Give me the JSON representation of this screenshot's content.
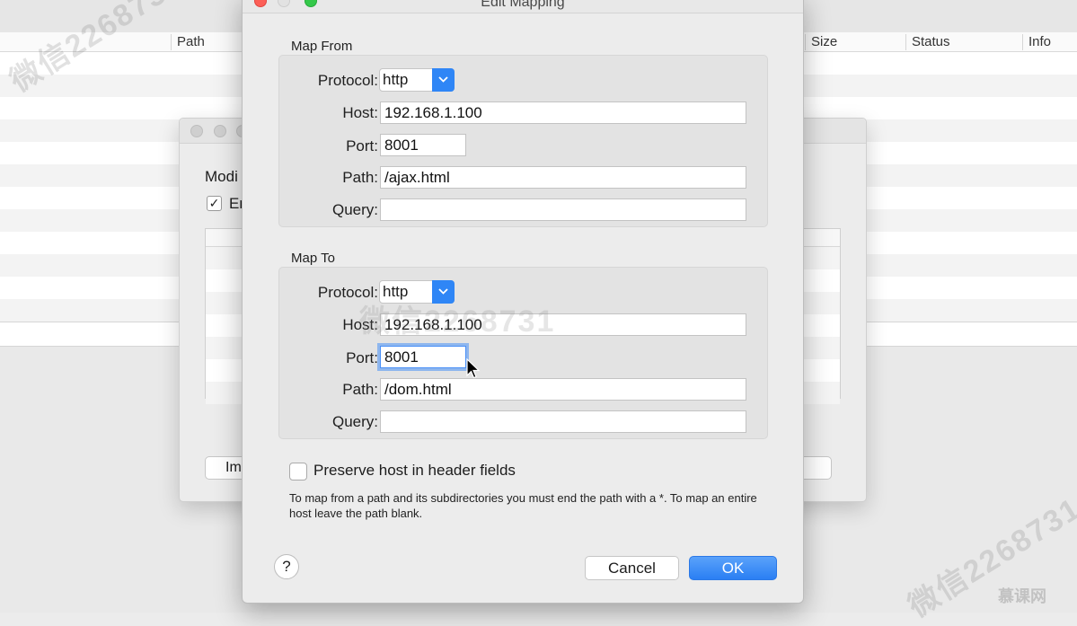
{
  "background": {
    "columns": [
      {
        "id": "path",
        "label": "Path"
      },
      {
        "id": "size",
        "label": "Size"
      },
      {
        "id": "status",
        "label": "Status"
      },
      {
        "id": "info",
        "label": "Info"
      }
    ]
  },
  "mid_dialog": {
    "label_partial": "Modi",
    "checkbox_label_partial": "En",
    "checkbox_mark": "✓",
    "button_partial": "Im"
  },
  "edit_mapping": {
    "title": "Edit Mapping",
    "map_from": {
      "title": "Map From",
      "protocol_label": "Protocol:",
      "protocol_value": "http",
      "host_label": "Host:",
      "host_value": "192.168.1.100",
      "port_label": "Port:",
      "port_value": "8001",
      "path_label": "Path:",
      "path_value": "/ajax.html",
      "query_label": "Query:",
      "query_value": ""
    },
    "map_to": {
      "title": "Map To",
      "protocol_label": "Protocol:",
      "protocol_value": "http",
      "host_label": "Host:",
      "host_value": "192.168.1.100",
      "port_label": "Port:",
      "port_value": "8001",
      "path_label": "Path:",
      "path_value": "/dom.html",
      "query_label": "Query:",
      "query_value": ""
    },
    "preserve_host_label": "Preserve host in header fields",
    "preserve_host_checked": false,
    "help_text": "To map from a path and its subdirectories you must end the path with a *. To map an entire host leave the path blank.",
    "help_button": "?",
    "cancel_label": "Cancel",
    "ok_label": "OK"
  },
  "watermark": {
    "text": "微信2268731",
    "logo_text": "慕课网"
  },
  "colors": {
    "accent": "#2f86f6",
    "close_red": "#fc5f57",
    "zoom_green": "#34c84a"
  }
}
